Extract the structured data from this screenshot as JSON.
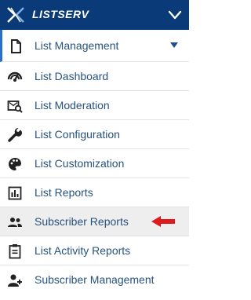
{
  "app": {
    "brand": "LISTSERV"
  },
  "menu": {
    "section_label": "List Management",
    "items": [
      {
        "label": "List Dashboard",
        "icon": "gauge-icon"
      },
      {
        "label": "List Moderation",
        "icon": "moderation-icon"
      },
      {
        "label": "List Configuration",
        "icon": "wrench-icon"
      },
      {
        "label": "List Customization",
        "icon": "palette-icon"
      },
      {
        "label": "List Reports",
        "icon": "bar-chart-icon"
      },
      {
        "label": "Subscriber Reports",
        "icon": "users-icon",
        "active": true
      },
      {
        "label": "List Activity Reports",
        "icon": "clipboard-icon"
      },
      {
        "label": "Subscriber Management",
        "icon": "add-user-icon"
      }
    ]
  },
  "colors": {
    "topbar": "#0b3a78",
    "label": "#27527e",
    "arrow": "#e0191b",
    "active_bg": "#eeeeee"
  }
}
